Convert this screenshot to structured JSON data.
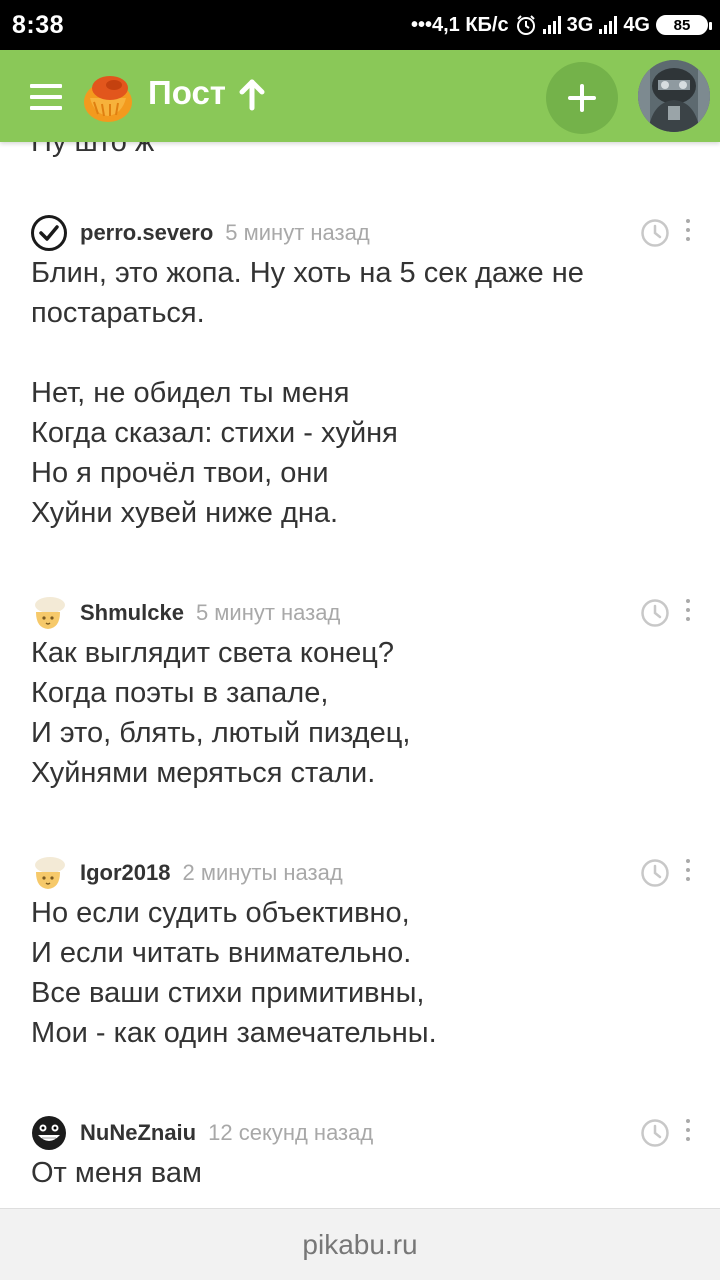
{
  "status_bar": {
    "time": "8:38",
    "speed": "•••4,1 КБ/с",
    "network1": "3G",
    "network2": "4G",
    "battery": "85"
  },
  "header": {
    "title": "Пост",
    "accent": "#8ac858"
  },
  "cut_text": "Ну што ж",
  "comments": [
    {
      "user": "perro.severo",
      "time": "5 минут назад",
      "avatar": "check-circle-avatar",
      "lines": [
        "Блин, это жопа. Ну хоть на 5 сек даже не",
        "постараться.",
        "",
        "Нет, не обидел ты меня",
        "Когда сказал: стихи - хуйня",
        "Но я прочёл твои, они",
        "Хуйни хувей ниже дна."
      ]
    },
    {
      "user": "Shmulcke",
      "time": "5 минут назад",
      "avatar": "default-avatar",
      "lines": [
        "Как выглядит света конец?",
        "Когда поэты в запале,",
        "И это, блять, лютый пиздец,",
        "Хуйнями меряться стали."
      ]
    },
    {
      "user": "Igor2018",
      "time": "2 минуты назад",
      "avatar": "default-avatar",
      "lines": [
        "Но если судить объективно,",
        "И если читать внимательно.",
        "Все ваши стихи примитивны,",
        "Мои - как один замечательны."
      ]
    },
    {
      "user": "NuNeZnaiu",
      "time": "12 секунд назад",
      "avatar": "grin-face-avatar",
      "lines": [
        "От меня вам"
      ]
    }
  ],
  "footer": {
    "domain": "pikabu.ru"
  }
}
